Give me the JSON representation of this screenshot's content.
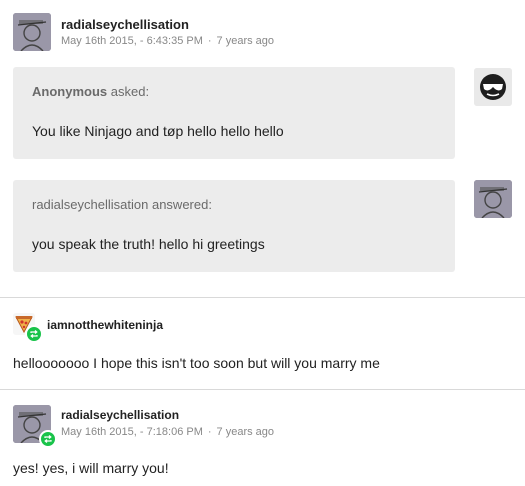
{
  "post1": {
    "username": "radialseychellisation",
    "date": "May 16th 2015, - 6:43:35 PM",
    "ago": "7 years ago"
  },
  "question": {
    "asker": "Anonymous",
    "asked_label": "asked:",
    "text": "You like Ninjago and tøp hello hello hello"
  },
  "answer": {
    "answerer": "radialseychellisation",
    "answered_label": "answered:",
    "text": "you speak the truth! hello hi greetings"
  },
  "reply1": {
    "username": "iamnotthewhiteninja",
    "text": "hellooooooo I hope this isn't too soon but will you marry me"
  },
  "reply2": {
    "username": "radialseychellisation",
    "date": "May 16th 2015, - 7:18:06 PM",
    "ago": "7 years ago",
    "text": "yes! yes, i will marry you!"
  },
  "icons": {
    "avatar_radial": "sketch-figure-avatar",
    "avatar_anon": "sunglasses-face-avatar",
    "avatar_ninja": "pizza-avatar",
    "reblog": "reblog-icon"
  },
  "colors": {
    "bubble_bg": "#ececec",
    "reblog_green": "#19c34a",
    "meta_gray": "#888888"
  }
}
